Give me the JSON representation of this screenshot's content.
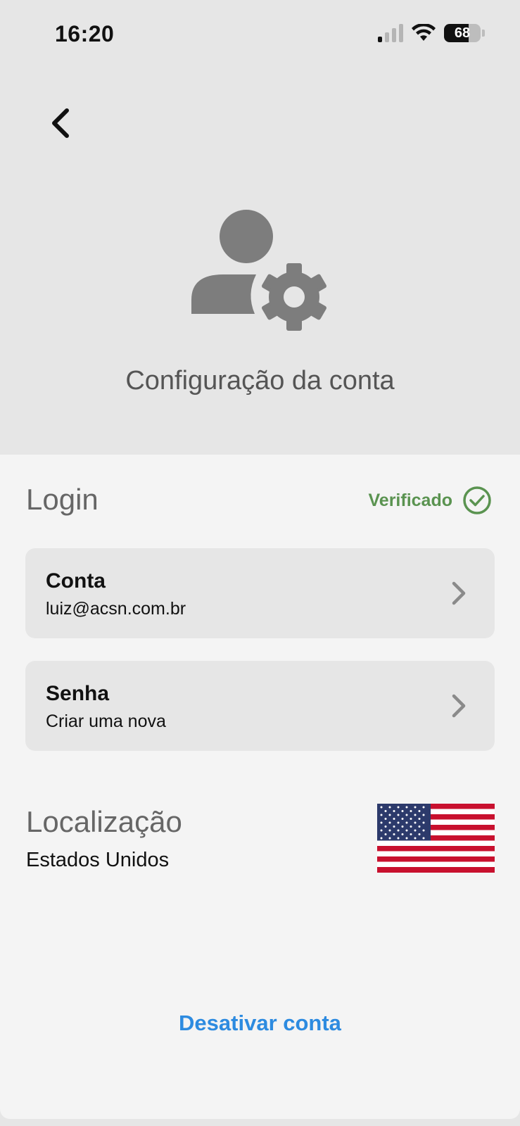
{
  "status_bar": {
    "time": "16:20",
    "battery_level": "68",
    "signal_icon": "cellular-signal-icon",
    "wifi_icon": "wifi-icon",
    "battery_icon": "battery-icon"
  },
  "header": {
    "back_icon": "chevron-left-icon",
    "hero_icon": "user-settings-icon",
    "title": "Configuração da conta"
  },
  "login": {
    "section_title": "Login",
    "status_text": "Verificado",
    "status_icon": "check-circle-icon",
    "status_color": "#5a9350"
  },
  "cards": {
    "account": {
      "title": "Conta",
      "subtitle": "luiz@acsn.com.br"
    },
    "password": {
      "title": "Senha",
      "subtitle": "Criar uma nova"
    }
  },
  "location": {
    "section_title": "Localização",
    "value": "Estados Unidos",
    "flag_icon": "us-flag-icon"
  },
  "actions": {
    "deactivate_label": "Desativar conta",
    "deactivate_color": "#2d8be0"
  }
}
